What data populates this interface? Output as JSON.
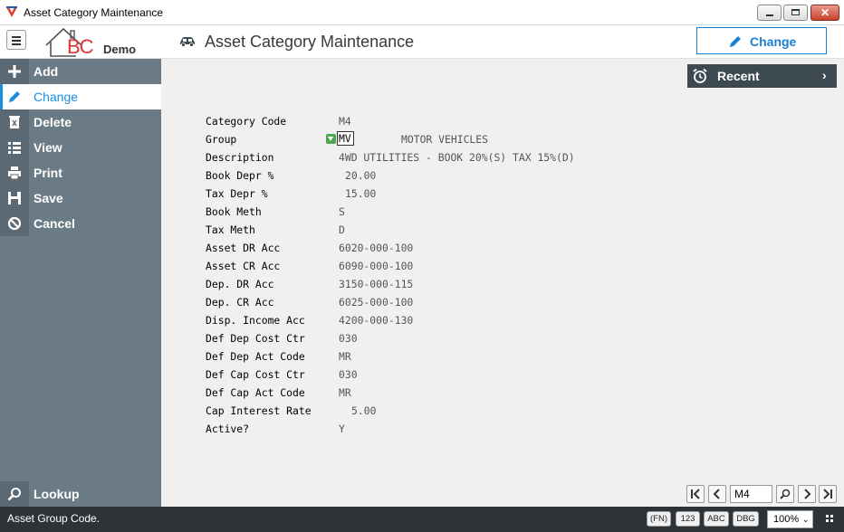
{
  "window": {
    "title": "Asset Category Maintenance"
  },
  "header": {
    "logo_text": "BC",
    "logo_subtitle": "Demo",
    "page_title": "Asset Category Maintenance",
    "change_button": "Change"
  },
  "sidebar": {
    "items": [
      {
        "label": "Add",
        "icon": "plus-icon"
      },
      {
        "label": "Change",
        "icon": "pencil-icon",
        "active": true
      },
      {
        "label": "Delete",
        "icon": "trash-icon"
      },
      {
        "label": "View",
        "icon": "list-icon"
      },
      {
        "label": "Print",
        "icon": "printer-icon"
      },
      {
        "label": "Save",
        "icon": "floppy-icon"
      },
      {
        "label": "Cancel",
        "icon": "cancel-icon"
      }
    ],
    "lookup": {
      "label": "Lookup",
      "icon": "search-icon"
    }
  },
  "recent": {
    "label": "Recent"
  },
  "form": {
    "fields": [
      {
        "label": "Category Code",
        "value": "M4"
      },
      {
        "label": "Group",
        "value": "MV",
        "description": "MOTOR VEHICLES"
      },
      {
        "label": "Description",
        "value": "4WD UTILITIES - BOOK 20%(S) TAX 15%(D)"
      },
      {
        "label": "Book Depr %",
        "value": "20.00"
      },
      {
        "label": "Tax Depr %",
        "value": "15.00"
      },
      {
        "label": "Book Meth",
        "value": "S"
      },
      {
        "label": "Tax Meth",
        "value": "D"
      },
      {
        "label": "Asset DR Acc",
        "value": "6020-000-100"
      },
      {
        "label": "Asset CR Acc",
        "value": "6090-000-100"
      },
      {
        "label": "Dep. DR Acc",
        "value": "3150-000-115"
      },
      {
        "label": "Dep. CR Acc",
        "value": "6025-000-100"
      },
      {
        "label": "Disp. Income Acc",
        "value": "4200-000-130"
      },
      {
        "label": "Def Dep Cost Ctr",
        "value": "030"
      },
      {
        "label": "Def Dep Act Code",
        "value": "MR"
      },
      {
        "label": "Def Cap Cost Ctr",
        "value": "030"
      },
      {
        "label": "Def Cap Act Code",
        "value": "MR"
      },
      {
        "label": "Cap Interest Rate",
        "value": "5.00"
      },
      {
        "label": "Active?",
        "value": "Y"
      }
    ]
  },
  "navigation": {
    "current_record": "M4"
  },
  "statusbar": {
    "message": "Asset Group Code.",
    "badges": [
      "(FN)",
      "123",
      "ABC",
      "DBG"
    ],
    "zoom": "100%"
  },
  "colors": {
    "sidebar": "#6b7b86",
    "accent": "#1a8ee0",
    "statusbar": "#2e3338",
    "recent": "#3e4a52"
  }
}
